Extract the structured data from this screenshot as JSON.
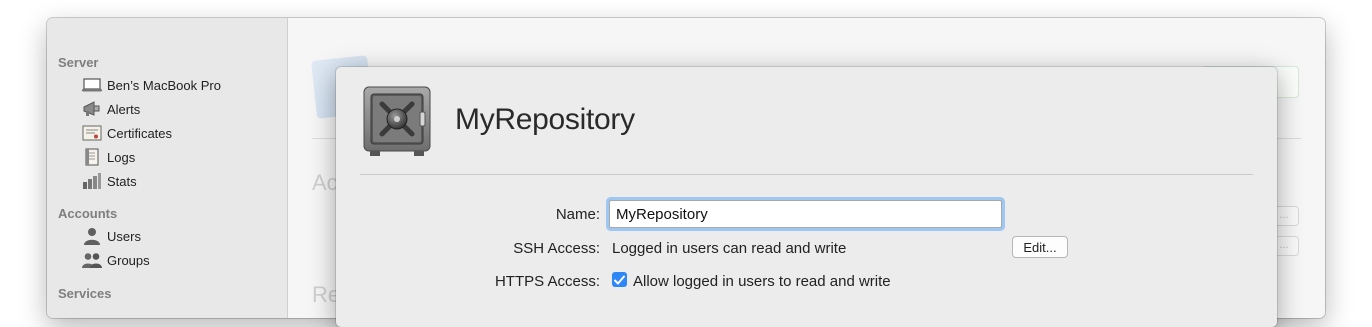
{
  "sidebar": {
    "server_header": "Server",
    "server_items": [
      {
        "label": "Ben’s MacBook Pro",
        "icon": "laptop-icon"
      },
      {
        "label": "Alerts",
        "icon": "megaphone-icon"
      },
      {
        "label": "Certificates",
        "icon": "certificate-icon"
      },
      {
        "label": "Logs",
        "icon": "log-icon"
      },
      {
        "label": "Stats",
        "icon": "stats-icon"
      }
    ],
    "accounts_header": "Accounts",
    "accounts_items": [
      {
        "label": "Users",
        "icon": "user-icon"
      },
      {
        "label": "Groups",
        "icon": "groups-icon"
      }
    ],
    "services_header": "Services"
  },
  "background": {
    "heading_1": "Ac",
    "heading_2": "Re",
    "ellipsis": "..."
  },
  "sheet": {
    "title": "MyRepository",
    "name_label": "Name:",
    "name_value": "MyRepository",
    "ssh_label": "SSH Access:",
    "ssh_value": "Logged in users can read and write",
    "edit_label": "Edit...",
    "https_label": "HTTPS Access:",
    "https_checked": true,
    "https_value": "Allow logged in users to read and write"
  },
  "colors": {
    "accent": "#2d87f6",
    "focus_ring": "#9ec7f2"
  }
}
